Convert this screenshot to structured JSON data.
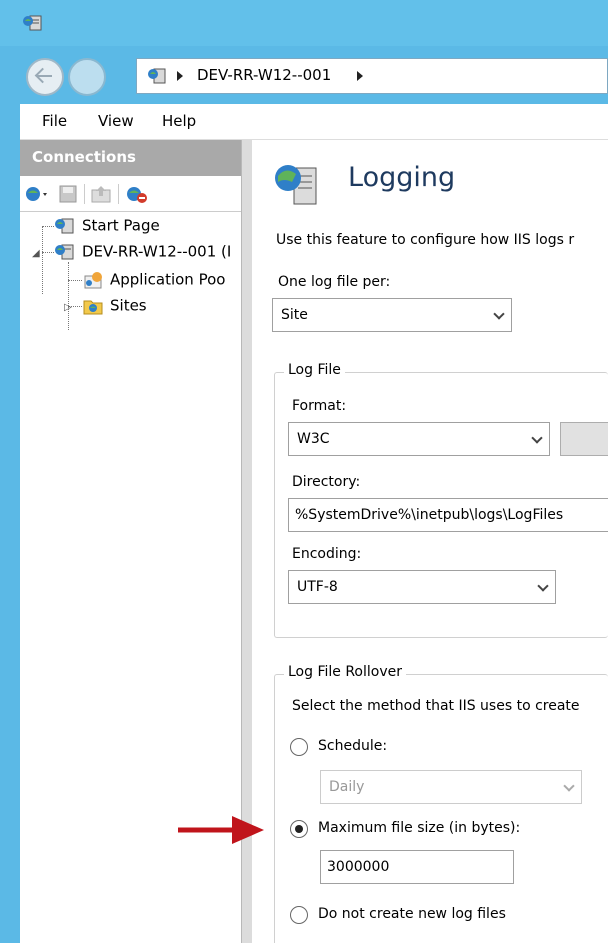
{
  "address": {
    "path": "DEV-RR-W12--001"
  },
  "menu": [
    "File",
    "View",
    "Help"
  ],
  "connections": {
    "title": "Connections",
    "tree": {
      "start_page": "Start Page",
      "server": "DEV-RR-W12--001 (I",
      "app_pools": "Application Poo",
      "sites": "Sites"
    }
  },
  "main": {
    "title": "Logging",
    "description": "Use this feature to configure how IIS logs r",
    "one_log_file_label": "One log file per:",
    "one_log_file_value": "Site",
    "log_file_group": "Log File",
    "format_label": "Format:",
    "format_value": "W3C",
    "directory_label": "Directory:",
    "directory_value": "%SystemDrive%\\inetpub\\logs\\LogFiles",
    "encoding_label": "Encoding:",
    "encoding_value": "UTF-8",
    "rollover_group": "Log File Rollover",
    "rollover_desc": "Select the method that IIS uses to create",
    "schedule_label": "Schedule:",
    "schedule_value": "Daily",
    "max_size_label": "Maximum file size (in bytes):",
    "max_size_value": "3000000",
    "no_new_label": "Do not create new log files",
    "rollover_selected": "max_size"
  },
  "colors": {
    "titlebar": "#62c0ea",
    "arrow": "#c0141b",
    "title_text": "#1e3a5f"
  }
}
